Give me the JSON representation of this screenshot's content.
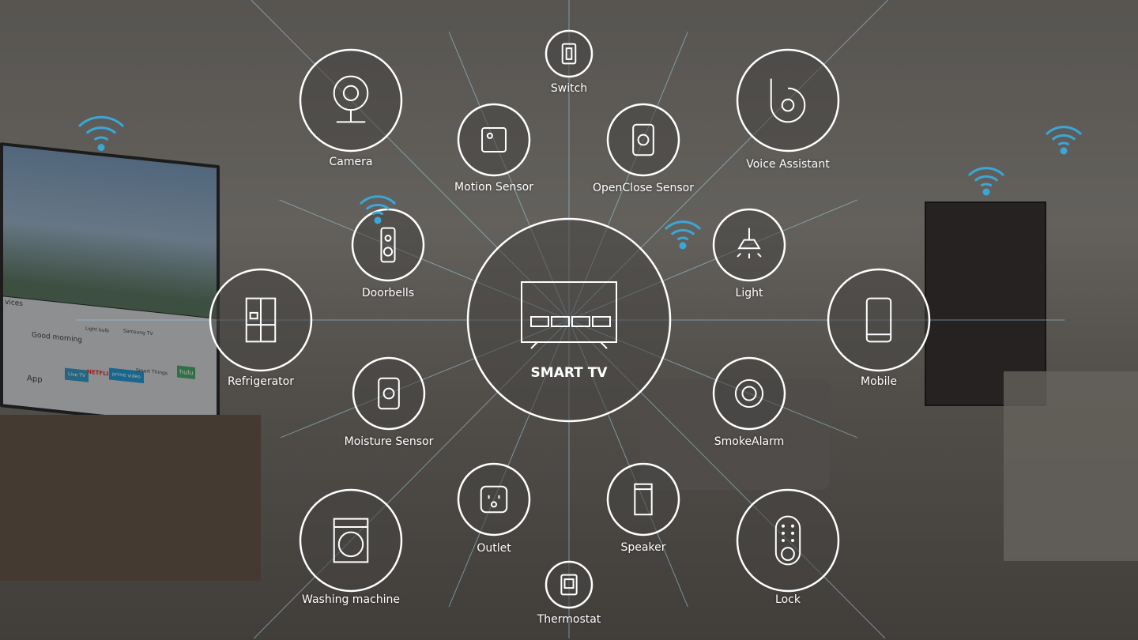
{
  "hub": {
    "label": "SMART TV",
    "icon": "tv-icon"
  },
  "devices": [
    {
      "label": "Switch",
      "icon": "switch-icon"
    },
    {
      "label": "Camera",
      "icon": "camera-icon"
    },
    {
      "label": "Motion Sensor",
      "icon": "motion-sensor-icon"
    },
    {
      "label": "OpenClose Sensor",
      "icon": "openclose-sensor-icon"
    },
    {
      "label": "Voice Assistant",
      "icon": "voice-assistant-icon"
    },
    {
      "label": "Doorbells",
      "icon": "doorbell-icon"
    },
    {
      "label": "Light",
      "icon": "light-icon"
    },
    {
      "label": "Refrigerator",
      "icon": "refrigerator-icon"
    },
    {
      "label": "Mobile",
      "icon": "mobile-icon"
    },
    {
      "label": "Moisture Sensor",
      "icon": "moisture-sensor-icon"
    },
    {
      "label": "SmokeAlarm",
      "icon": "smoke-alarm-icon"
    },
    {
      "label": "Outlet",
      "icon": "outlet-icon"
    },
    {
      "label": "Speaker",
      "icon": "speaker-icon"
    },
    {
      "label": "Washing machine",
      "icon": "washing-machine-icon"
    },
    {
      "label": "Lock",
      "icon": "lock-icon"
    },
    {
      "label": "Thermostat",
      "icon": "thermostat-icon"
    }
  ],
  "tv_screen": {
    "section": "vices",
    "cards": [
      "Good morning",
      "Light bulb",
      "Samsung TV"
    ],
    "apps": [
      "App",
      "Live TV",
      "NETFLIX",
      "prime video",
      "Smart Things",
      "hulu"
    ]
  },
  "colors": {
    "line": "#9fd3e6",
    "circle": "#ffffff",
    "wifi": "#3aa7d6"
  }
}
